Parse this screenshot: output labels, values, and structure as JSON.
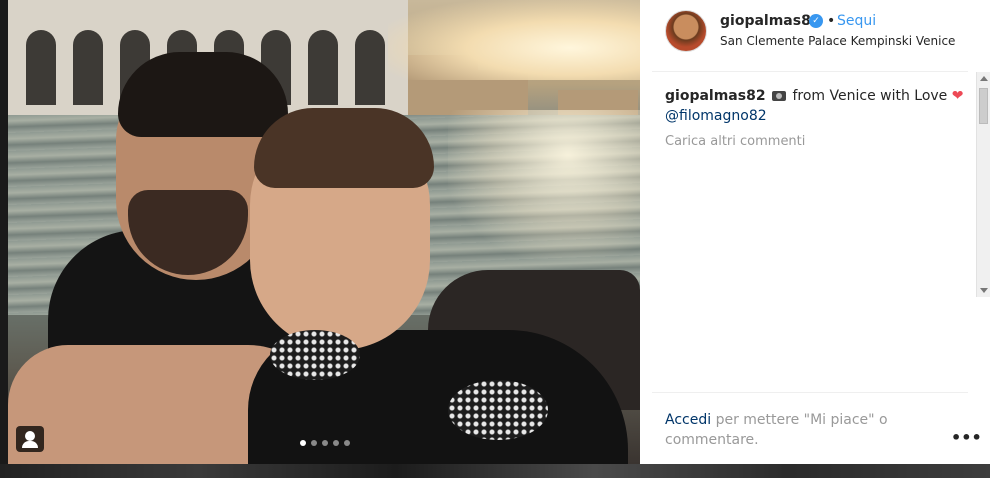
{
  "post": {
    "username": "giopalmas82",
    "follow_separator": "•",
    "follow_label": "Sequi",
    "location": "San Clemente Palace Kempinski Venice"
  },
  "caption": {
    "author": "giopalmas82",
    "icon_camera": "camera-icon",
    "text": "from Venice with Love",
    "icon_heart": "heart-icon",
    "heart_glyph": "❤",
    "mention": "@filomagno82"
  },
  "comments": {
    "load_more": "Carica altri commenti"
  },
  "actions": {
    "login_link": "Accedi",
    "login_text": " per mettere \"Mi piace\" o commentare.",
    "more_glyph": "•••"
  },
  "carousel": {
    "total": 5,
    "active_index": 0
  },
  "colors": {
    "accent": "#3897f0",
    "link": "#003569",
    "heart": "#ed4956"
  }
}
